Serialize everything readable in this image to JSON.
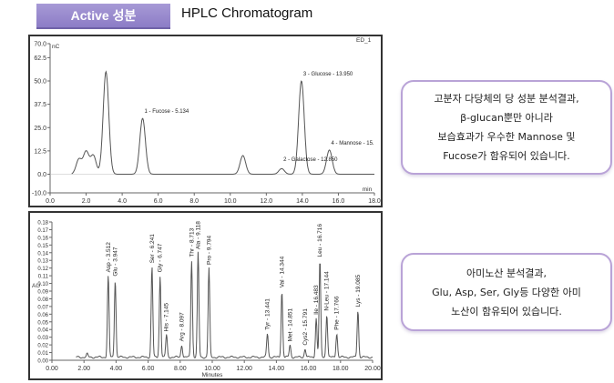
{
  "header": {
    "tag_label": "Active 성분",
    "title": "HPLC Chromatogram"
  },
  "colors": {
    "tag_bg": "#9a8acf",
    "note_border": "#b9a3d7",
    "trace": "#555555"
  },
  "chart_data": [
    {
      "type": "line",
      "title": "",
      "top_right_label": "ED_1",
      "ylabel": "nC",
      "xlabel": "min",
      "xlim": [
        0.0,
        18.0
      ],
      "ylim": [
        -10.0,
        70.0
      ],
      "xticks": [
        "0.0",
        "2.0",
        "4.0",
        "6.0",
        "8.0",
        "10.0",
        "12.0",
        "14.0",
        "16.0",
        "18.0"
      ],
      "yticks": [
        "-10.0",
        "0.0",
        "12.5",
        "25.0",
        "37.5",
        "50.0",
        "62.5",
        "70.0"
      ],
      "peaks": [
        {
          "x": 1.6,
          "y": 8
        },
        {
          "x": 2.0,
          "y": 12
        },
        {
          "x": 2.4,
          "y": 10
        },
        {
          "x": 3.1,
          "y": 55
        },
        {
          "x": 5.134,
          "y": 30
        },
        {
          "x": 10.7,
          "y": 10
        },
        {
          "x": 12.85,
          "y": 3
        },
        {
          "x": 13.95,
          "y": 50
        },
        {
          "x": 15.5,
          "y": 13
        }
      ],
      "peak_labels": [
        {
          "text": "1 - Fucose - 5.134",
          "x": 5.134,
          "y": 32
        },
        {
          "text": "2 - Galactose - 12.850",
          "x": 12.85,
          "y": 6
        },
        {
          "text": "3 - Glucose - 13.950",
          "x": 13.95,
          "y": 52
        },
        {
          "text": "4 - Mannose - 15.",
          "x": 15.5,
          "y": 15
        }
      ]
    },
    {
      "type": "line",
      "title": "",
      "ylabel": "AU",
      "xlabel": "Minutes",
      "xlim": [
        0.0,
        20.0
      ],
      "ylim": [
        0.0,
        0.18
      ],
      "xticks": [
        "0.00",
        "2.00",
        "4.00",
        "6.00",
        "8.00",
        "10.00",
        "12.00",
        "14.00",
        "16.00",
        "18.00",
        "20.00"
      ],
      "yticks": [
        "0.00",
        "0.01",
        "0.02",
        "0.03",
        "0.04",
        "0.05",
        "0.06",
        "0.07",
        "0.08",
        "0.09",
        "0.10",
        "0.11",
        "0.12",
        "0.13",
        "0.14",
        "0.15",
        "0.16",
        "0.17",
        "0.18"
      ],
      "peaks": [
        {
          "x": 2.2,
          "y": 0.008
        },
        {
          "x": 3.512,
          "y": 0.11
        },
        {
          "x": 3.947,
          "y": 0.105
        },
        {
          "x": 6.241,
          "y": 0.122
        },
        {
          "x": 6.747,
          "y": 0.11
        },
        {
          "x": 7.145,
          "y": 0.033
        },
        {
          "x": 8.097,
          "y": 0.02
        },
        {
          "x": 8.713,
          "y": 0.13
        },
        {
          "x": 9.118,
          "y": 0.14
        },
        {
          "x": 9.794,
          "y": 0.12
        },
        {
          "x": 13.441,
          "y": 0.035
        },
        {
          "x": 14.344,
          "y": 0.09
        },
        {
          "x": 14.851,
          "y": 0.02
        },
        {
          "x": 15.791,
          "y": 0.015
        },
        {
          "x": 16.483,
          "y": 0.055
        },
        {
          "x": 16.716,
          "y": 0.13
        },
        {
          "x": 17.144,
          "y": 0.06
        },
        {
          "x": 17.766,
          "y": 0.035
        },
        {
          "x": 19.085,
          "y": 0.065
        }
      ],
      "peak_labels": [
        {
          "text": "Asp - 3.512",
          "x": 3.512,
          "y": 0.112
        },
        {
          "text": "Glu - 3.947",
          "x": 3.947,
          "y": 0.107
        },
        {
          "text": "Ser - 6.241",
          "x": 6.241,
          "y": 0.124
        },
        {
          "text": "Gly - 6.747",
          "x": 6.747,
          "y": 0.112
        },
        {
          "text": "His - 7.145",
          "x": 7.145,
          "y": 0.035
        },
        {
          "text": "Arg - 8.097",
          "x": 8.097,
          "y": 0.022
        },
        {
          "text": "Thr - 8.713",
          "x": 8.713,
          "y": 0.132
        },
        {
          "text": "Ala - 9.118",
          "x": 9.118,
          "y": 0.142
        },
        {
          "text": "Pro - 9.794",
          "x": 9.794,
          "y": 0.122
        },
        {
          "text": "Tyr - 13.441",
          "x": 13.441,
          "y": 0.037
        },
        {
          "text": "Val - 14.344",
          "x": 14.344,
          "y": 0.092
        },
        {
          "text": "Met - 14.851",
          "x": 14.851,
          "y": 0.022
        },
        {
          "text": "Cys2 - 15.791",
          "x": 15.791,
          "y": 0.017
        },
        {
          "text": "Ile - 16.483",
          "x": 16.483,
          "y": 0.057
        },
        {
          "text": "Leu - 16.716",
          "x": 16.716,
          "y": 0.132
        },
        {
          "text": "N-Leu - 17.144",
          "x": 17.144,
          "y": 0.062
        },
        {
          "text": "Phe - 17.766",
          "x": 17.766,
          "y": 0.037
        },
        {
          "text": "Lys - 19.085",
          "x": 19.085,
          "y": 0.067
        }
      ]
    }
  ],
  "notes": [
    {
      "lines": [
        "고분자 다당체의 당 성분 분석결과,",
        "β-glucan뿐만 아니라",
        "보습효과가 우수한 Mannose 및",
        "Fucose가 함유되어 있습니다."
      ]
    },
    {
      "lines": [
        "아미노산 분석결과,",
        "Glu, Asp, Ser, Gly등 다양한 아미",
        "노산이 함유되어 있습니다."
      ]
    }
  ]
}
